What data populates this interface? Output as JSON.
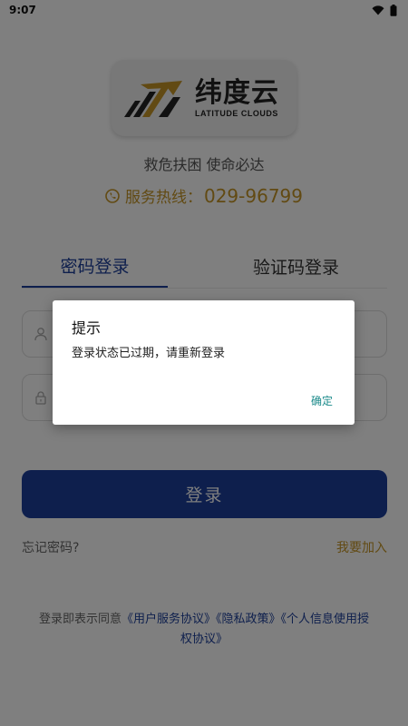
{
  "status_bar": {
    "time": "9:07"
  },
  "brand": {
    "name_cn": "纬度云",
    "name_en": "LATITUDE CLOUDS",
    "color_gold": "#c49526",
    "color_dark": "#222222"
  },
  "slogan": "救危扶困 使命必达",
  "hotline": {
    "label": "服务热线：",
    "number": "029-96799"
  },
  "tabs": [
    {
      "label": "密码登录",
      "active": true
    },
    {
      "label": "验证码登录",
      "active": false
    }
  ],
  "form": {
    "username": {
      "value": "",
      "placeholder": ""
    },
    "password": {
      "value": "",
      "placeholder": ""
    }
  },
  "login_button": "登录",
  "forgot_password": "忘记密码?",
  "join": "我要加入",
  "agreement": {
    "prefix": "登录即表示同意",
    "links": [
      "《用户服务协议》",
      "《隐私政策》",
      "《个人信息使用授权协议》"
    ]
  },
  "dialog": {
    "title": "提示",
    "message": "登录状态已过期，请重新登录",
    "ok": "确定"
  },
  "colors": {
    "primary": "#1c3f9a",
    "accent": "#c49526",
    "dialog_button": "#1b8a8a"
  }
}
